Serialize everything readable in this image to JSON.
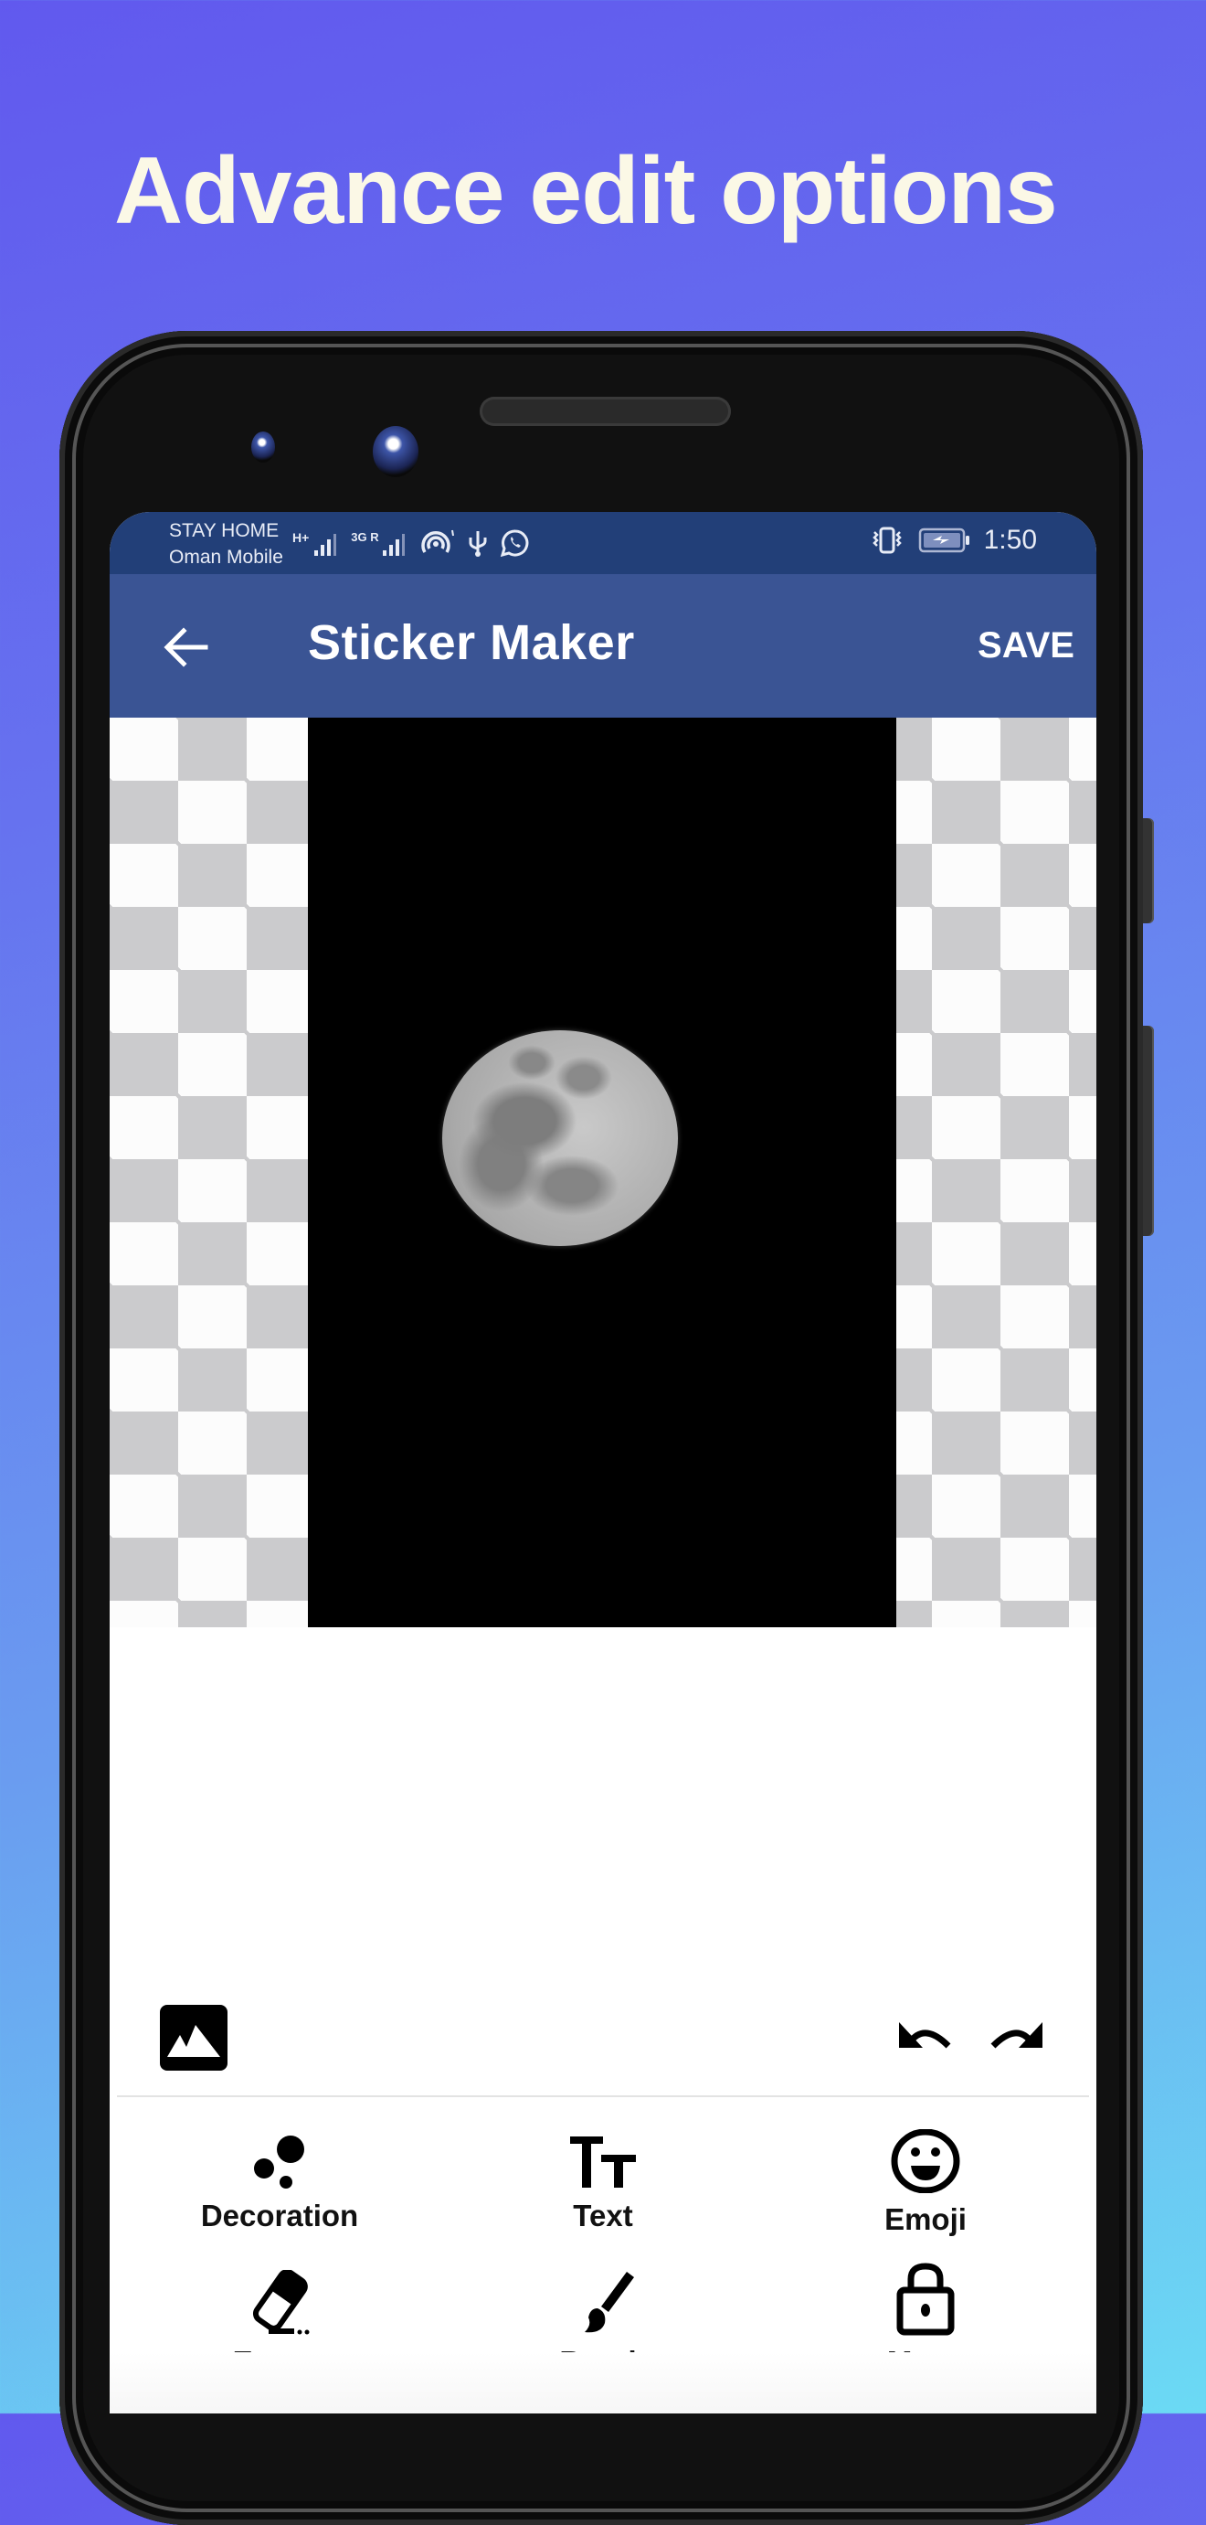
{
  "promo": {
    "headline": "Advance edit options"
  },
  "status_bar": {
    "carrier_line1": "STAY HOME",
    "carrier_line2": "Oman Mobile",
    "network1": "H+",
    "network2": "3G R",
    "time": "1:50",
    "icons": [
      "signal-h-plus-icon",
      "signal-3g-roaming-icon",
      "hotspot-icon",
      "usb-icon",
      "whatsapp-icon",
      "vibrate-icon",
      "battery-charging-icon"
    ]
  },
  "app_bar": {
    "title": "Sticker Maker",
    "save_label": "SAVE",
    "back_icon": "arrow-left-icon"
  },
  "canvas": {
    "background": "transparency-checkerboard",
    "image": "full-moon-photo"
  },
  "actions": {
    "gallery_icon": "image-icon",
    "undo_icon": "undo-icon",
    "redo_icon": "redo-icon"
  },
  "tools": [
    {
      "label": "Decoration",
      "icon": "bubbles-icon"
    },
    {
      "label": "Text",
      "icon": "text-size-icon"
    },
    {
      "label": "Emoji",
      "icon": "smiley-icon"
    },
    {
      "label": "Eraser",
      "icon": "eraser-icon"
    },
    {
      "label": "Brush",
      "icon": "brush-icon"
    },
    {
      "label": "Move",
      "icon": "lock-icon"
    }
  ],
  "colors": {
    "status_bar": "#223f78",
    "app_bar": "#3a5494",
    "headline": "#fbf8e6",
    "checker_dark": "#cbcbcd",
    "checker_light": "#fcfcfc"
  }
}
